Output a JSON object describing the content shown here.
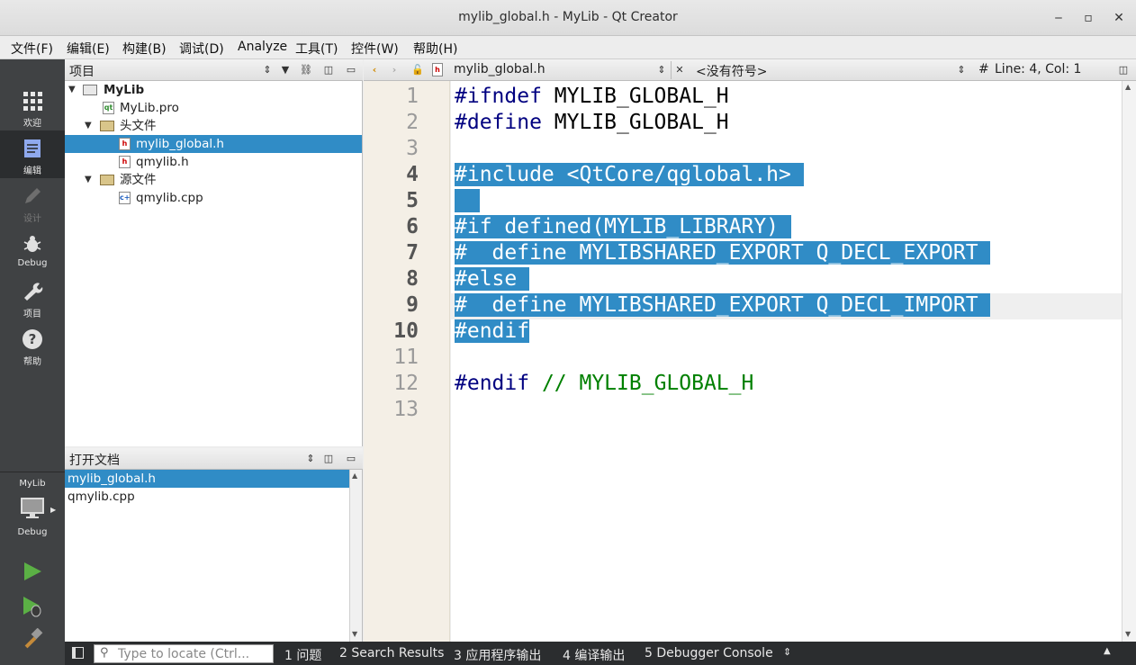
{
  "window": {
    "title": "mylib_global.h - MyLib - Qt Creator",
    "minimize": "‒",
    "maximize": "▫",
    "close": "✕"
  },
  "menu": [
    {
      "label": "文件(F)"
    },
    {
      "label": "编辑(E)"
    },
    {
      "label": "构建(B)"
    },
    {
      "label": "调试(D)"
    },
    {
      "label": "Analyze"
    },
    {
      "label": "工具(T)"
    },
    {
      "label": "控件(W)"
    },
    {
      "label": "帮助(H)"
    }
  ],
  "modes": [
    {
      "label": "欢迎"
    },
    {
      "label": "编辑"
    },
    {
      "label": "设计"
    },
    {
      "label": "Debug"
    },
    {
      "label": "项目"
    },
    {
      "label": "帮助"
    }
  ],
  "kit": {
    "project": "MyLib",
    "config": "Debug"
  },
  "project_pane": {
    "title": "项目",
    "tree": [
      {
        "label": "MyLib"
      },
      {
        "label": "MyLib.pro"
      },
      {
        "label": "头文件"
      },
      {
        "label": "mylib_global.h"
      },
      {
        "label": "qmylib.h"
      },
      {
        "label": "源文件"
      },
      {
        "label": "qmylib.cpp"
      }
    ]
  },
  "open_docs": {
    "title": "打开文档",
    "items": [
      {
        "label": "mylib_global.h"
      },
      {
        "label": "qmylib.cpp"
      }
    ]
  },
  "editor": {
    "file": "mylib_global.h",
    "symbol": "<没有符号>",
    "position": "Line: 4, Col: 1",
    "hash": "#",
    "lines": [
      {
        "n": "1",
        "a": "#ifndef",
        "b": " MYLIB_GLOBAL_H"
      },
      {
        "n": "2",
        "a": "#define",
        "b": " MYLIB_GLOBAL_H"
      },
      {
        "n": "3",
        "a": "",
        "b": ""
      },
      {
        "n": "4",
        "a": "#include <QtCore/qglobal.h>",
        "b": ""
      },
      {
        "n": "5",
        "a": " ",
        "b": ""
      },
      {
        "n": "6",
        "a": "#if defined(MYLIB_LIBRARY)",
        "b": ""
      },
      {
        "n": "7",
        "a": "#  define MYLIBSHARED_EXPORT Q_DECL_EXPORT",
        "b": ""
      },
      {
        "n": "8",
        "a": "#else",
        "b": ""
      },
      {
        "n": "9",
        "a": "#  define MYLIBSHARED_EXPORT Q_DECL_IMPORT",
        "b": ""
      },
      {
        "n": "10",
        "a": "#endif",
        "b": ""
      },
      {
        "n": "11",
        "a": "",
        "b": ""
      },
      {
        "n": "12",
        "a": "#endif",
        "b": " // MYLIB_GLOBAL_H"
      },
      {
        "n": "13",
        "a": "",
        "b": ""
      }
    ]
  },
  "status": {
    "locator_placeholder": "Type to locate (Ctrl...",
    "panes": [
      {
        "label": "1 问题"
      },
      {
        "label": "2 Search Results"
      },
      {
        "label": "3 应用程序输出"
      },
      {
        "label": "4 编译输出"
      },
      {
        "label": "5 Debugger Console"
      }
    ]
  },
  "colors": {
    "selection": "#308cc6",
    "sidebar": "#404244",
    "preprocessor": "#000080",
    "comment": "#008000"
  }
}
